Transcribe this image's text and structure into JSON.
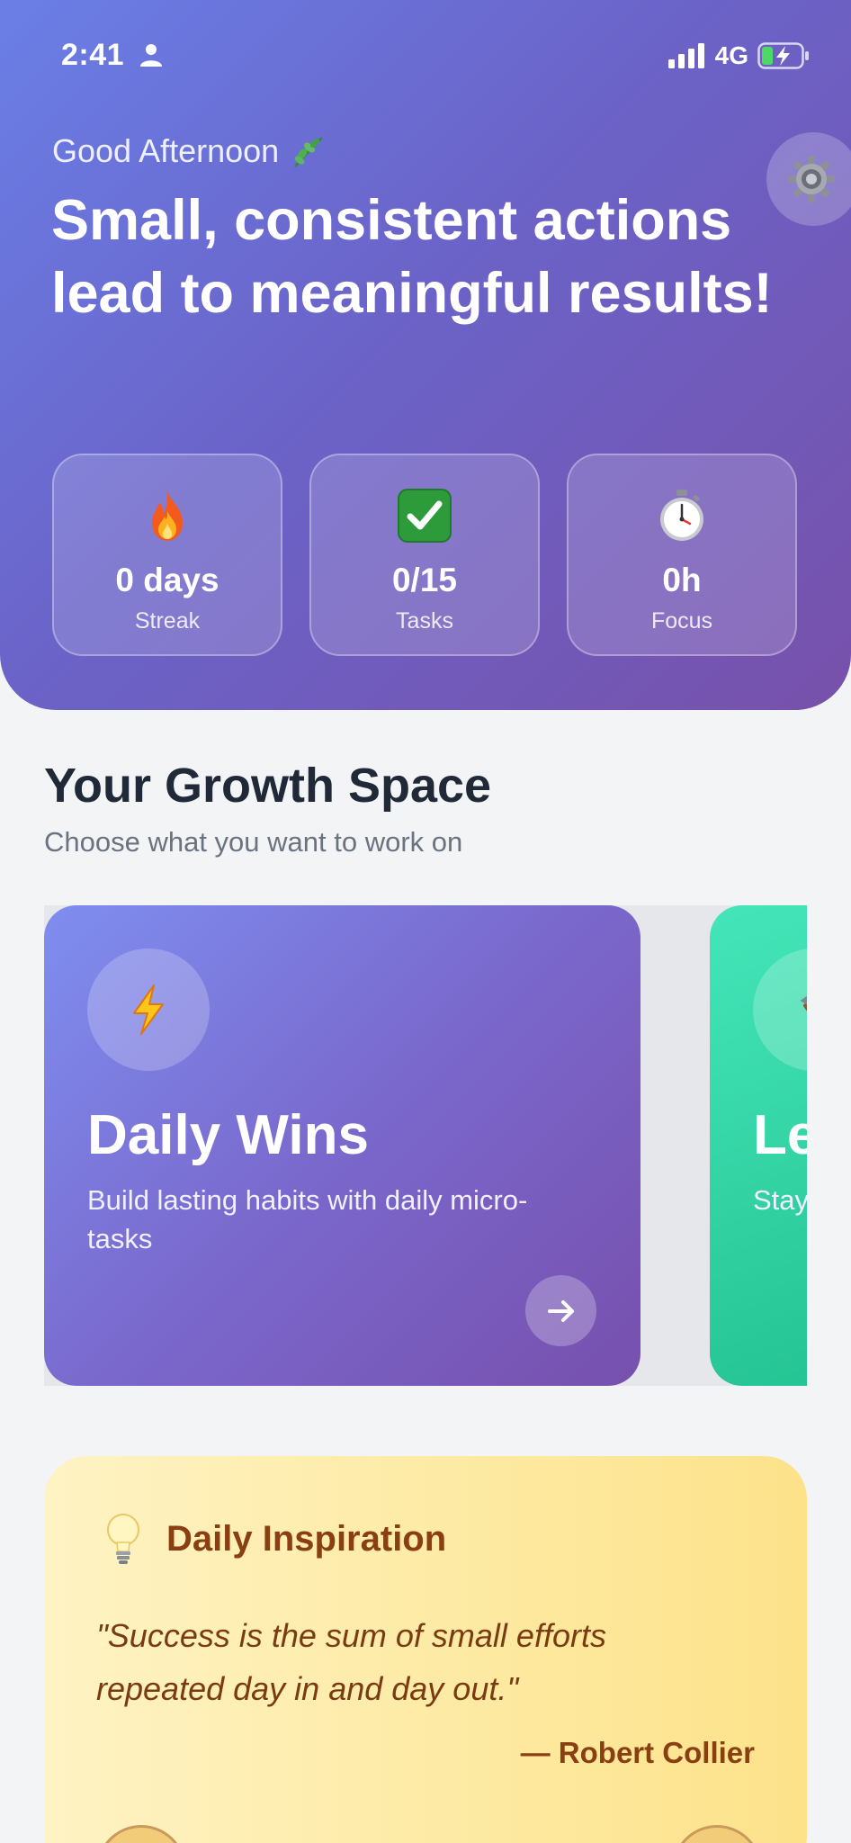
{
  "status_bar": {
    "time": "2:41",
    "network": "4G"
  },
  "hero": {
    "greeting": "Good Afternoon",
    "headline": "Small, consistent actions lead to meaningful results!",
    "stats": [
      {
        "icon": "fire-icon",
        "value": "0 days",
        "label": "Streak"
      },
      {
        "icon": "check-icon",
        "value": "0/15",
        "label": "Tasks"
      },
      {
        "icon": "stopwatch-icon",
        "value": "0h",
        "label": "Focus"
      }
    ]
  },
  "growth": {
    "title": "Your Growth Space",
    "subtitle": "Choose what you want to work on",
    "cards": [
      {
        "icon": "lightning-icon",
        "title": "Daily Wins",
        "description": "Build lasting habits with daily micro-tasks"
      },
      {
        "icon": "hammer-icon",
        "title": "Le",
        "description": "Stay long"
      }
    ]
  },
  "inspiration": {
    "title": "Daily Inspiration",
    "quote": "\"Success is the sum of small efforts repeated day in and day out.\"",
    "author": "— Robert Collier"
  },
  "colors": {
    "hero_start": "#6a7fe6",
    "hero_end": "#7751ab",
    "card_green": "#22c08f",
    "inspiration_text": "#8a3f12"
  }
}
